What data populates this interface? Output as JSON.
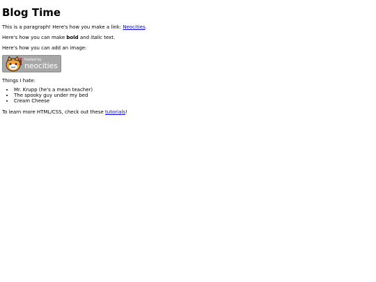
{
  "title": "Blog Time",
  "para1": {
    "text": "This is a paragraph! Here's how you make a link: ",
    "link": "Neocities",
    "end": "."
  },
  "para2": {
    "before": "Here's how you can make ",
    "bold": "bold",
    "middle": " and ",
    "italic": "italic",
    "after": " text."
  },
  "para3": "Here's how you can add an image:",
  "badge": {
    "small_text": "hosted by",
    "big_text": "neocities",
    "icon": "neocities-cat-logo"
  },
  "para4": "Things I hate:",
  "hates": [
    "Mr. Krupp (he's a mean teacher)",
    "The spooky guy under my bed",
    "Cream Cheese"
  ],
  "para5": {
    "before": "To learn more HTML/CSS, check out these ",
    "link": "tutorials",
    "after": "!"
  },
  "colors": {
    "link": "#0000ee",
    "badge_bg": "#a7a7a7"
  }
}
